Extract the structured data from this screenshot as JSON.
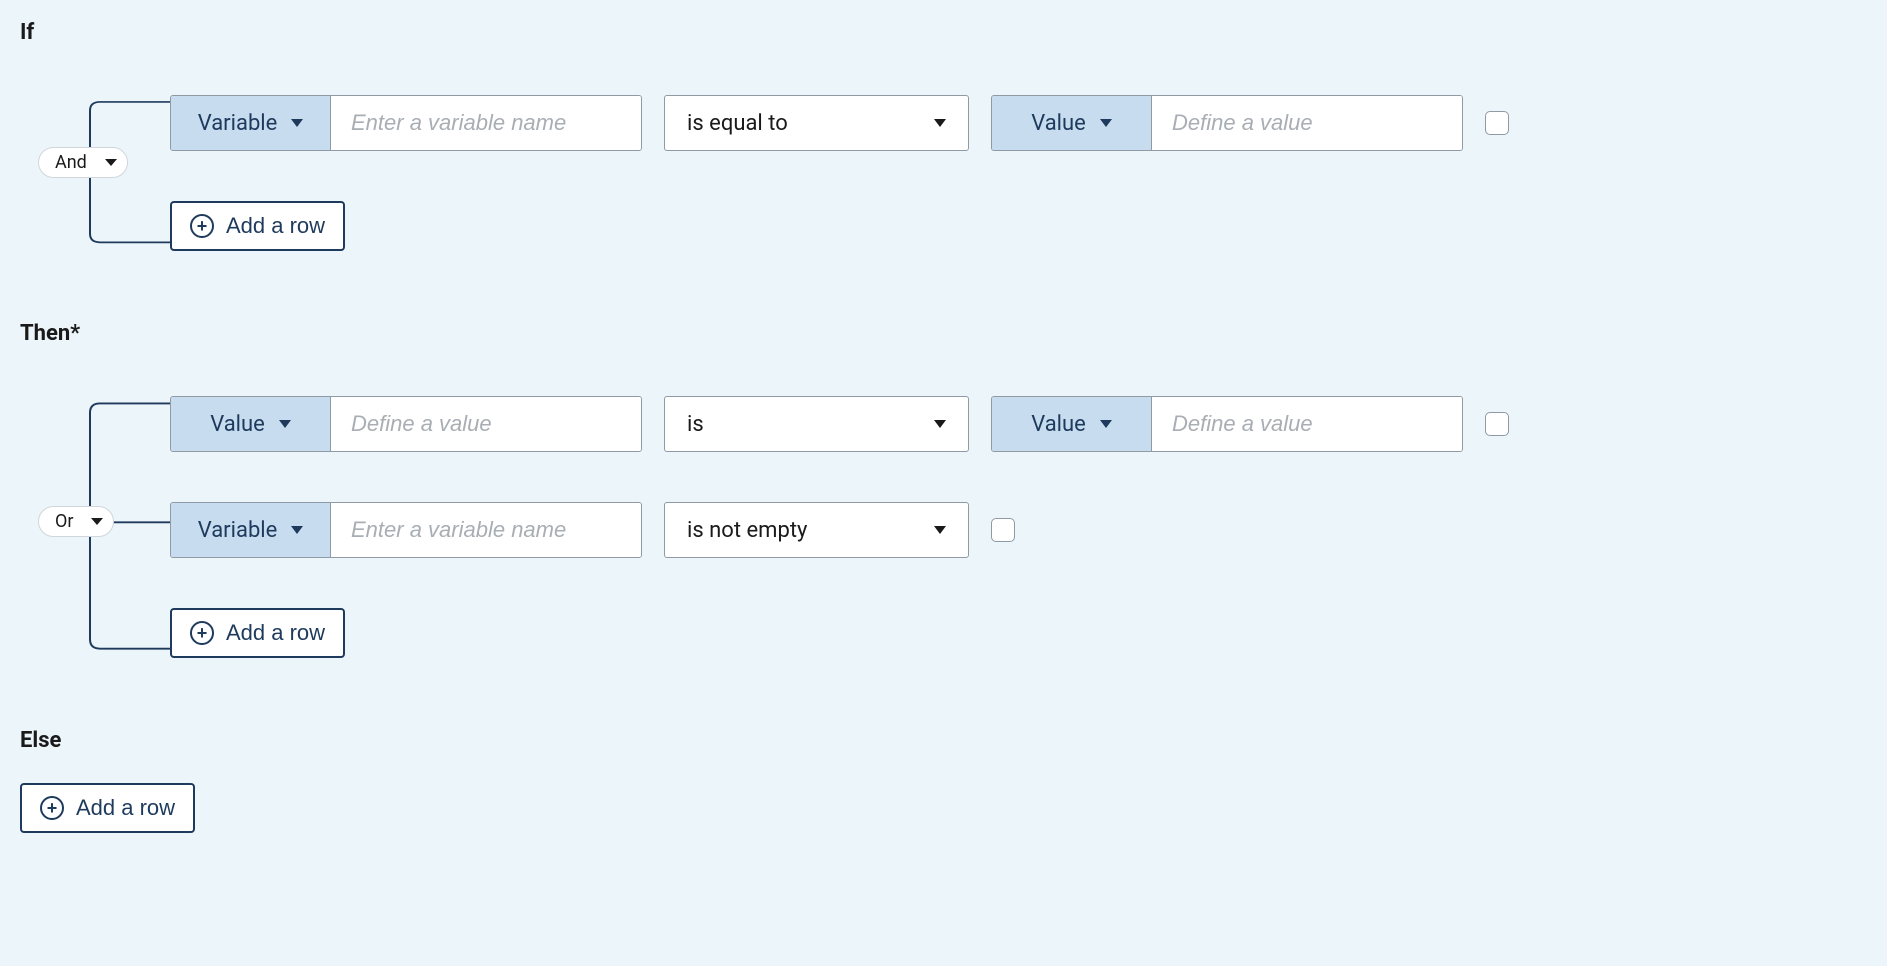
{
  "labels": {
    "if": "If",
    "then": "Then*",
    "else": "Else",
    "add_row": "Add a row"
  },
  "type_labels": {
    "variable": "Variable",
    "value": "Value"
  },
  "placeholders": {
    "variable": "Enter a variable name",
    "value": "Define a value"
  },
  "logic_ops": {
    "and": "And",
    "or": "Or"
  },
  "if_block": {
    "logic": "And",
    "rows": [
      {
        "left_type": "Variable",
        "left_placeholder": "Enter a variable name",
        "operator": "is equal to",
        "right_type": "Value",
        "right_placeholder": "Define a value",
        "has_right": true
      }
    ]
  },
  "then_block": {
    "logic": "Or",
    "rows": [
      {
        "left_type": "Value",
        "left_placeholder": "Define a value",
        "operator": "is",
        "right_type": "Value",
        "right_placeholder": "Define a value",
        "has_right": true
      },
      {
        "left_type": "Variable",
        "left_placeholder": "Enter a variable name",
        "operator": "is not empty",
        "has_right": false
      }
    ]
  },
  "else_block": {
    "rows": []
  }
}
